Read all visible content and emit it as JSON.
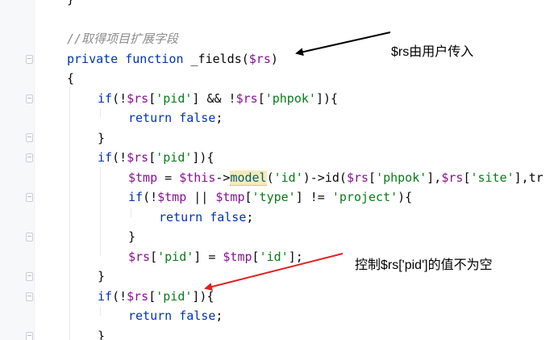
{
  "code": {
    "lines": [
      {
        "indent": 0,
        "tokens": [
          {
            "t": "}",
            "c": "pl"
          }
        ]
      },
      {
        "indent": 0,
        "tokens": []
      },
      {
        "indent": 0,
        "tokens": [
          {
            "t": "//取得项目扩展字段",
            "c": "cmt"
          }
        ]
      },
      {
        "indent": 0,
        "tokens": [
          {
            "t": "private",
            "c": "kw"
          },
          {
            "t": " ",
            "c": "pl"
          },
          {
            "t": "function",
            "c": "kw"
          },
          {
            "t": " _fields(",
            "c": "pl"
          },
          {
            "t": "$rs",
            "c": "var"
          },
          {
            "t": ")",
            "c": "pl"
          }
        ]
      },
      {
        "indent": 0,
        "tokens": [
          {
            "t": "{",
            "c": "pl"
          }
        ]
      },
      {
        "indent": 1,
        "tokens": [
          {
            "t": "if",
            "c": "kw"
          },
          {
            "t": "(!",
            "c": "pl"
          },
          {
            "t": "$rs",
            "c": "var"
          },
          {
            "t": "[",
            "c": "pl"
          },
          {
            "t": "'pid'",
            "c": "str"
          },
          {
            "t": "] && !",
            "c": "pl"
          },
          {
            "t": "$rs",
            "c": "var"
          },
          {
            "t": "[",
            "c": "pl"
          },
          {
            "t": "'phpok'",
            "c": "str"
          },
          {
            "t": "]){",
            "c": "pl"
          }
        ]
      },
      {
        "indent": 2,
        "tokens": [
          {
            "t": "return",
            "c": "kw"
          },
          {
            "t": " ",
            "c": "pl"
          },
          {
            "t": "false",
            "c": "kw"
          },
          {
            "t": ";",
            "c": "pl"
          }
        ]
      },
      {
        "indent": 1,
        "tokens": [
          {
            "t": "}",
            "c": "pl"
          }
        ]
      },
      {
        "indent": 1,
        "tokens": [
          {
            "t": "if",
            "c": "kw"
          },
          {
            "t": "(!",
            "c": "pl"
          },
          {
            "t": "$rs",
            "c": "var"
          },
          {
            "t": "[",
            "c": "pl"
          },
          {
            "t": "'pid'",
            "c": "str"
          },
          {
            "t": "]){",
            "c": "pl"
          }
        ]
      },
      {
        "indent": 2,
        "tokens": [
          {
            "t": "$tmp",
            "c": "var"
          },
          {
            "t": " = ",
            "c": "pl"
          },
          {
            "t": "$this",
            "c": "var"
          },
          {
            "t": "->",
            "c": "pl"
          },
          {
            "t": "model",
            "c": "fn warn"
          },
          {
            "t": "(",
            "c": "pl"
          },
          {
            "t": "'id'",
            "c": "str"
          },
          {
            "t": ")->id(",
            "c": "pl"
          },
          {
            "t": "$rs",
            "c": "var"
          },
          {
            "t": "[",
            "c": "pl"
          },
          {
            "t": "'phpok'",
            "c": "str"
          },
          {
            "t": "],",
            "c": "pl"
          },
          {
            "t": "$rs",
            "c": "var"
          },
          {
            "t": "[",
            "c": "pl"
          },
          {
            "t": "'site'",
            "c": "str"
          },
          {
            "t": "],tr",
            "c": "pl"
          }
        ]
      },
      {
        "indent": 2,
        "tokens": [
          {
            "t": "if",
            "c": "kw"
          },
          {
            "t": "(!",
            "c": "pl"
          },
          {
            "t": "$tmp",
            "c": "var"
          },
          {
            "t": " || ",
            "c": "pl"
          },
          {
            "t": "$tmp",
            "c": "var"
          },
          {
            "t": "[",
            "c": "pl"
          },
          {
            "t": "'type'",
            "c": "str"
          },
          {
            "t": "] != ",
            "c": "pl"
          },
          {
            "t": "'project'",
            "c": "str"
          },
          {
            "t": "){",
            "c": "pl"
          }
        ]
      },
      {
        "indent": 3,
        "tokens": [
          {
            "t": "return",
            "c": "kw"
          },
          {
            "t": " ",
            "c": "pl"
          },
          {
            "t": "false",
            "c": "kw"
          },
          {
            "t": ";",
            "c": "pl"
          }
        ]
      },
      {
        "indent": 2,
        "tokens": [
          {
            "t": "}",
            "c": "pl"
          }
        ]
      },
      {
        "indent": 2,
        "tokens": [
          {
            "t": "$rs",
            "c": "var"
          },
          {
            "t": "[",
            "c": "pl"
          },
          {
            "t": "'pid'",
            "c": "str"
          },
          {
            "t": "] = ",
            "c": "pl"
          },
          {
            "t": "$tmp",
            "c": "var"
          },
          {
            "t": "[",
            "c": "pl"
          },
          {
            "t": "'id'",
            "c": "str"
          },
          {
            "t": "];",
            "c": "pl"
          }
        ]
      },
      {
        "indent": 1,
        "tokens": [
          {
            "t": "}",
            "c": "pl"
          }
        ]
      },
      {
        "indent": 1,
        "tokens": [
          {
            "t": "if",
            "c": "kw"
          },
          {
            "t": "(!",
            "c": "pl"
          },
          {
            "t": "$rs",
            "c": "var"
          },
          {
            "t": "[",
            "c": "pl"
          },
          {
            "t": "'pid'",
            "c": "str"
          },
          {
            "t": "]){",
            "c": "pl"
          }
        ]
      },
      {
        "indent": 2,
        "tokens": [
          {
            "t": "return",
            "c": "kw"
          },
          {
            "t": " ",
            "c": "pl"
          },
          {
            "t": "false",
            "c": "kw"
          },
          {
            "t": ";",
            "c": "pl"
          }
        ]
      },
      {
        "indent": 1,
        "tokens": [
          {
            "t": "}",
            "c": "pl"
          }
        ]
      }
    ]
  },
  "annotations": {
    "rs_input": "$rs由用户传入",
    "pid_not_empty": "控制$rs['pid']的值不为空"
  },
  "colors": {
    "keyword": "#0033b3",
    "variable": "#871094",
    "string": "#067d17",
    "comment": "#8c8c8c",
    "function": "#00627a",
    "arrow_black": "#000000",
    "arrow_red": "#e02020"
  }
}
